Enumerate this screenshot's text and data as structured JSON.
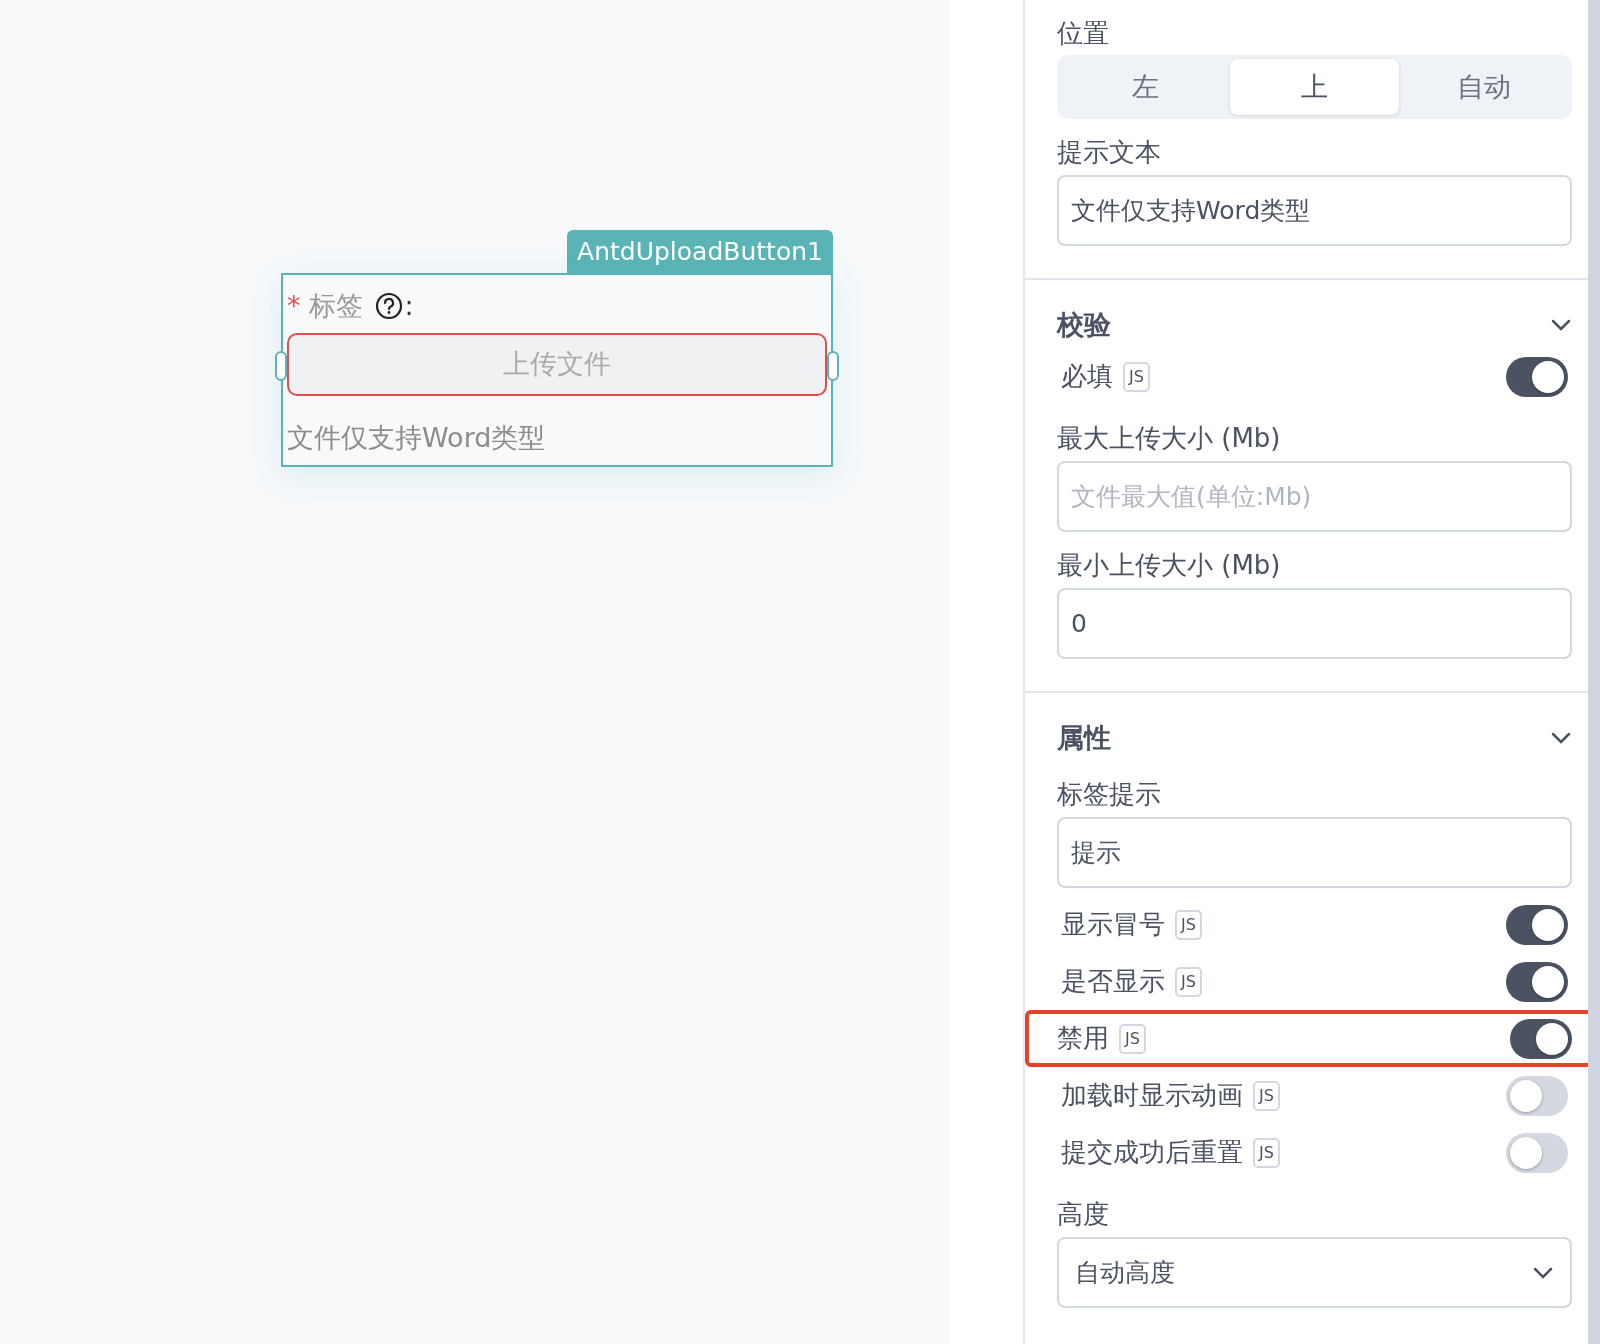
{
  "canvas": {
    "widget": {
      "tag": "AntdUploadButton1",
      "required_mark": "*",
      "label": "标签",
      "colon": ":",
      "button": "上传文件",
      "button_error": true,
      "help_text": "文件仅支持Word类型"
    }
  },
  "panel": {
    "position": {
      "label": "位置",
      "options": [
        {
          "label": "左",
          "selected": false
        },
        {
          "label": "上",
          "selected": true
        },
        {
          "label": "自动",
          "selected": false
        }
      ]
    },
    "hint_text": {
      "label": "提示文本",
      "value": "文件仅支持Word类型"
    },
    "sections": [
      {
        "title": "校验",
        "expanded": true,
        "items": [
          {
            "kind": "toggle",
            "label": "必填",
            "js": "JS",
            "on": true,
            "highlighted": false
          },
          {
            "kind": "input",
            "label": "最大上传大小 (Mb)",
            "placeholder": "文件最大值(单位:Mb)"
          },
          {
            "kind": "input",
            "label": "最小上传大小 (Mb)",
            "value": "0"
          }
        ]
      },
      {
        "title": "属性",
        "expanded": true,
        "items": [
          {
            "kind": "input",
            "label": "标签提示",
            "value": "提示"
          },
          {
            "kind": "toggle",
            "label": "显示冒号",
            "js": "JS",
            "on": true,
            "highlighted": false
          },
          {
            "kind": "toggle",
            "label": "是否显示",
            "js": "JS",
            "on": true,
            "highlighted": false
          },
          {
            "kind": "toggle",
            "label": "禁用",
            "js": "JS",
            "on": true,
            "highlighted": true
          },
          {
            "kind": "toggle",
            "label": "加载时显示动画",
            "js": "JS",
            "on": false,
            "highlighted": false
          },
          {
            "kind": "toggle",
            "label": "提交成功后重置",
            "js": "JS",
            "on": false,
            "highlighted": false
          },
          {
            "kind": "select",
            "label": "高度",
            "value": "自动高度"
          }
        ]
      }
    ]
  }
}
